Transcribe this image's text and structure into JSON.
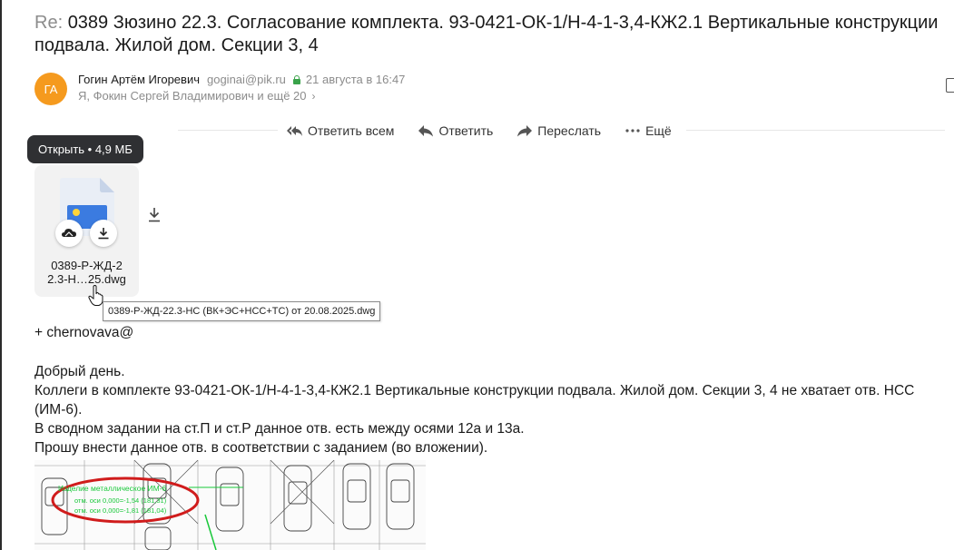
{
  "email": {
    "subject_prefix": "Re:",
    "subject": "0389 Зюзино 22.3. Согласование комплекта. 93-0421-ОК-1/Н-4-1-3,4-КЖ2.1 Вертикальные конструкции подвала. Жилой дом. Секции 3, 4",
    "sender": {
      "initials": "ГА",
      "avatar_color": "#f59a1e",
      "name": "Гогин Артём Игоревич",
      "email": "goginai@pik.ru",
      "date": "21 августа в 16:47"
    },
    "recipients": "Я, Фокин Сергей Владимирович и ещё 20"
  },
  "actions": {
    "reply_all": "Ответить всем",
    "reply": "Ответить",
    "forward": "Переслать",
    "more": "Ещё"
  },
  "attachment": {
    "open_tooltip": "Открыть • 4,9 МБ",
    "name_short_line1": "0389-Р-ЖД-2",
    "name_short_line2": "2.3-Н…25.dwg",
    "full_name_tooltip": "0389-Р-ЖД-22.3-НС (ВК+ЭС+НСС+ТС) от 20.08.2025.dwg"
  },
  "body": {
    "mention": "+ chernovava@",
    "greeting": "Добрый день.",
    "line1": "Коллеги в комплекте 93-0421-ОК-1/Н-4-1-3,4-КЖ2.1 Вертикальные конструкции подвала. Жилой дом. Секции 3, 4 не хватает отв. НСС (ИМ-6).",
    "line2": "В сводном задании на ст.П и ст.Р данное отв. есть между осями 12а и 13а.",
    "line3": "Прошу внести данное отв. в соответствии с заданием (во вложении)."
  },
  "drawing": {
    "label1": "Изделие металлическое ИМ-6",
    "label2": "отм. оси 0,000=-1,54 (181,31)",
    "label3": "отм. оси 0,000=-1,81 (181,04)"
  },
  "colors": {
    "accent_green": "#3aa34a",
    "annotation_red": "#d01c1c",
    "drawing_green": "#19c83a"
  }
}
